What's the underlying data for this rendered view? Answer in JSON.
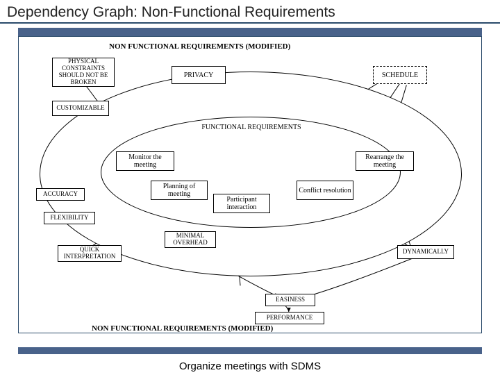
{
  "title": "Dependency Graph: Non-Functional Requirements",
  "heading_top": "NON FUNCTIONAL REQUIREMENTS (MODIFIED)",
  "heading_bottom": "NON FUNCTIONAL REQUIREMENTS (MODIFIED)",
  "inner_label": "FUNCTIONAL REQUIREMENTS",
  "nodes": {
    "physical": "PHYSICAL CONSTRAINTS SHOULD NOT BE BROKEN",
    "customizable": "CUSTOMIZABLE",
    "privacy": "PRIVACY",
    "schedule": "SCHEDULE",
    "monitor": "Monitor the meeting",
    "planning": "Planning of meeting",
    "participant": "Participant interaction",
    "conflict": "Conflict resolution",
    "rearrange": "Rearrange the meeting",
    "accuracy": "ACCURACY",
    "flexibility": "FLEXIBILITY",
    "quick": "QUICK INTERPRETATION",
    "minimal": "MINIMAL OVERHEAD",
    "dynamically": "DYNAMICALLY",
    "easiness": "EASINESS",
    "performance": "PERFORMANCE"
  },
  "caption": "Organize meetings with SDMS"
}
